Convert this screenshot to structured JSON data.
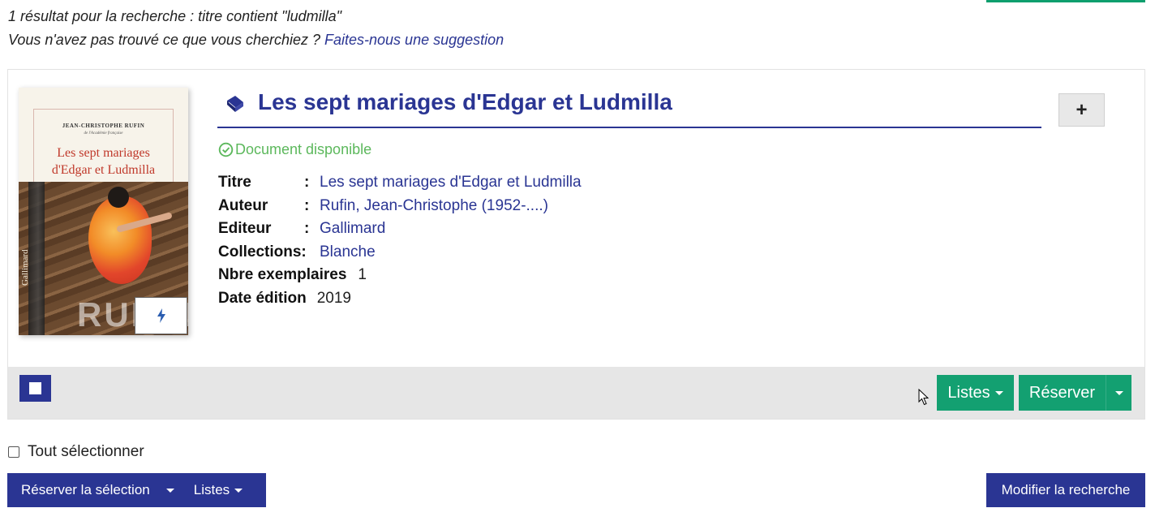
{
  "search": {
    "summary": "1 résultat pour la recherche : titre contient \"ludmilla\"",
    "not_found_prompt": "Vous n'avez pas trouvé ce que vous cherchiez ?",
    "suggestion_link": "Faites-nous une suggestion"
  },
  "result": {
    "title": "Les sept mariages d'Edgar et Ludmilla",
    "doc_type_icon": "book-icon",
    "availability": "Document disponible",
    "availability_color": "#5cb85c",
    "cover": {
      "author": "JEAN-CHRISTOPHE RUFIN",
      "academy": "de l'Académie française",
      "title_line1": "Les sept mariages",
      "title_line2": "d'Edgar et Ludmilla",
      "name": "RUFIN",
      "publisher": "Gallimard"
    },
    "fields": [
      {
        "label": "Titre",
        "colon": ":",
        "value": "Les sept mariages d'Edgar et Ludmilla"
      },
      {
        "label": "Auteur",
        "colon": ":",
        "value": "Rufin, Jean-Christophe (1952-....)"
      },
      {
        "label": "Editeur",
        "colon": ":",
        "value": "Gallimard"
      },
      {
        "label": "Collections:",
        "colon": "",
        "value": "Blanche"
      },
      {
        "label": "Nbre exemplaires",
        "colon": "",
        "value": "1"
      },
      {
        "label": "Date édition",
        "colon": "",
        "value": "2019"
      }
    ],
    "plus_label": "+",
    "listes_label": "Listes",
    "reserver_label": "Réserver"
  },
  "bulk": {
    "select_all": "Tout sélectionner",
    "reserve_selection": "Réserver la sélection",
    "listes": "Listes",
    "modify_search": "Modifier la recherche"
  },
  "colors": {
    "primary": "#2a3593",
    "action_green": "#13a071"
  }
}
